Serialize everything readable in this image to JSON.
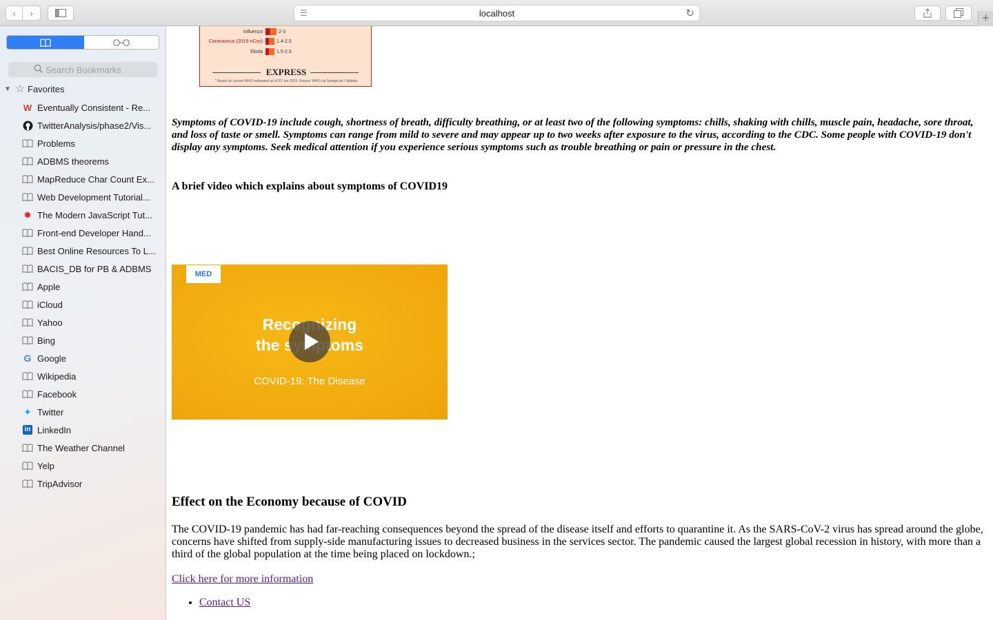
{
  "browser": {
    "address": "localhost"
  },
  "sidebar": {
    "search_placeholder": "Search Bookmarks",
    "favorites_label": "Favorites",
    "items": [
      {
        "label": "Eventually Consistent - Re...",
        "icon": "w-favicon"
      },
      {
        "label": "TwitterAnalysis/phase2/Vis...",
        "icon": "github-icon"
      },
      {
        "label": "Problems",
        "icon": "book-icon"
      },
      {
        "label": "ADBMS theorems",
        "icon": "book-icon"
      },
      {
        "label": "MapReduce Char Count Ex...",
        "icon": "book-icon"
      },
      {
        "label": "Web Development Tutorial...",
        "icon": "book-icon"
      },
      {
        "label": "The Modern JavaScript Tut...",
        "icon": "js-tutorial-icon"
      },
      {
        "label": "Front-end Developer Hand...",
        "icon": "book-icon"
      },
      {
        "label": "Best Online Resources To L...",
        "icon": "book-icon"
      },
      {
        "label": "BACIS_DB for PB & ADBMS",
        "icon": "book-icon"
      },
      {
        "label": "Apple",
        "icon": "book-icon"
      },
      {
        "label": "iCloud",
        "icon": "book-icon"
      },
      {
        "label": "Yahoo",
        "icon": "book-icon"
      },
      {
        "label": "Bing",
        "icon": "book-icon"
      },
      {
        "label": "Google",
        "icon": "google-icon"
      },
      {
        "label": "Wikipedia",
        "icon": "book-icon"
      },
      {
        "label": "Facebook",
        "icon": "book-icon"
      },
      {
        "label": "Twitter",
        "icon": "twitter-icon"
      },
      {
        "label": "LinkedIn",
        "icon": "linkedin-icon"
      },
      {
        "label": "The Weather Channel",
        "icon": "book-icon"
      },
      {
        "label": "Yelp",
        "icon": "book-icon"
      },
      {
        "label": "TripAdvisor",
        "icon": "book-icon"
      }
    ]
  },
  "chart_image": {
    "rows": [
      {
        "label": "Influenza",
        "value": "2-3",
        "fill": 0.4
      },
      {
        "label": "Coronavirus (2019 nCov)",
        "value": "1.4-2.5",
        "fill": 0.32
      },
      {
        "label": "Ebola",
        "value": "1.5-2.5",
        "fill": 0.32
      }
    ],
    "brand": "EXPRESS",
    "source": "* Based on current WHO estimated as of 23 Jan 2019. Source: WHO via Spiegel.de / Statista"
  },
  "content": {
    "symptoms": "Symptoms of COVID-19 include cough, shortness of breath, difficulty breathing, or at least two of the following symptoms: chills, shaking with chills, muscle pain, headache, sore throat, and loss of taste or smell. Symptoms can range from mild to severe and may appear up to two weeks after exposure to the virus, according to the CDC. Some people with COVID-19 don't display any symptoms. Seek medical attention if you experience serious symptoms such as trouble breathing or pain or pressure in the chest.",
    "video_heading": "A brief video which explains about symptoms of COVID19",
    "video": {
      "logo": "MED",
      "title": "Recognizing\nthe symptoms",
      "subtitle": "COVID-19: The Disease"
    },
    "econ_heading": "Effect on the Economy because of COVID",
    "econ_text": "The COVID-19 pandemic has had far-reaching consequences beyond the spread of the disease itself and efforts to quarantine it. As the SARS-CoV-2 virus has spread around the globe, concerns have shifted from supply-side manufacturing issues to decreased business in the services sector. The pandemic caused the largest global recession in history, with more than a third of the global population at the time being placed on lockdown.;",
    "more_link": "Click here for more information",
    "contact_link": "Contact US"
  }
}
